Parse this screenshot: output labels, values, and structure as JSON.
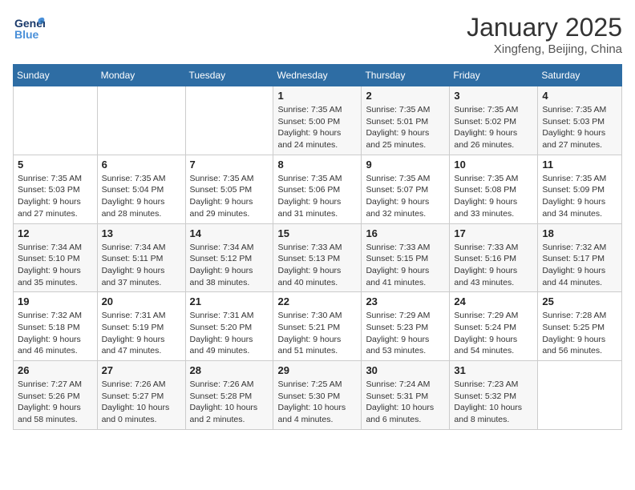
{
  "logo": {
    "line1": "General",
    "line2": "Blue"
  },
  "title": "January 2025",
  "subtitle": "Xingfeng, Beijing, China",
  "days_header": [
    "Sunday",
    "Monday",
    "Tuesday",
    "Wednesday",
    "Thursday",
    "Friday",
    "Saturday"
  ],
  "weeks": [
    [
      {
        "day": "",
        "info": ""
      },
      {
        "day": "",
        "info": ""
      },
      {
        "day": "",
        "info": ""
      },
      {
        "day": "1",
        "info": "Sunrise: 7:35 AM\nSunset: 5:00 PM\nDaylight: 9 hours\nand 24 minutes."
      },
      {
        "day": "2",
        "info": "Sunrise: 7:35 AM\nSunset: 5:01 PM\nDaylight: 9 hours\nand 25 minutes."
      },
      {
        "day": "3",
        "info": "Sunrise: 7:35 AM\nSunset: 5:02 PM\nDaylight: 9 hours\nand 26 minutes."
      },
      {
        "day": "4",
        "info": "Sunrise: 7:35 AM\nSunset: 5:03 PM\nDaylight: 9 hours\nand 27 minutes."
      }
    ],
    [
      {
        "day": "5",
        "info": "Sunrise: 7:35 AM\nSunset: 5:03 PM\nDaylight: 9 hours\nand 27 minutes."
      },
      {
        "day": "6",
        "info": "Sunrise: 7:35 AM\nSunset: 5:04 PM\nDaylight: 9 hours\nand 28 minutes."
      },
      {
        "day": "7",
        "info": "Sunrise: 7:35 AM\nSunset: 5:05 PM\nDaylight: 9 hours\nand 29 minutes."
      },
      {
        "day": "8",
        "info": "Sunrise: 7:35 AM\nSunset: 5:06 PM\nDaylight: 9 hours\nand 31 minutes."
      },
      {
        "day": "9",
        "info": "Sunrise: 7:35 AM\nSunset: 5:07 PM\nDaylight: 9 hours\nand 32 minutes."
      },
      {
        "day": "10",
        "info": "Sunrise: 7:35 AM\nSunset: 5:08 PM\nDaylight: 9 hours\nand 33 minutes."
      },
      {
        "day": "11",
        "info": "Sunrise: 7:35 AM\nSunset: 5:09 PM\nDaylight: 9 hours\nand 34 minutes."
      }
    ],
    [
      {
        "day": "12",
        "info": "Sunrise: 7:34 AM\nSunset: 5:10 PM\nDaylight: 9 hours\nand 35 minutes."
      },
      {
        "day": "13",
        "info": "Sunrise: 7:34 AM\nSunset: 5:11 PM\nDaylight: 9 hours\nand 37 minutes."
      },
      {
        "day": "14",
        "info": "Sunrise: 7:34 AM\nSunset: 5:12 PM\nDaylight: 9 hours\nand 38 minutes."
      },
      {
        "day": "15",
        "info": "Sunrise: 7:33 AM\nSunset: 5:13 PM\nDaylight: 9 hours\nand 40 minutes."
      },
      {
        "day": "16",
        "info": "Sunrise: 7:33 AM\nSunset: 5:15 PM\nDaylight: 9 hours\nand 41 minutes."
      },
      {
        "day": "17",
        "info": "Sunrise: 7:33 AM\nSunset: 5:16 PM\nDaylight: 9 hours\nand 43 minutes."
      },
      {
        "day": "18",
        "info": "Sunrise: 7:32 AM\nSunset: 5:17 PM\nDaylight: 9 hours\nand 44 minutes."
      }
    ],
    [
      {
        "day": "19",
        "info": "Sunrise: 7:32 AM\nSunset: 5:18 PM\nDaylight: 9 hours\nand 46 minutes."
      },
      {
        "day": "20",
        "info": "Sunrise: 7:31 AM\nSunset: 5:19 PM\nDaylight: 9 hours\nand 47 minutes."
      },
      {
        "day": "21",
        "info": "Sunrise: 7:31 AM\nSunset: 5:20 PM\nDaylight: 9 hours\nand 49 minutes."
      },
      {
        "day": "22",
        "info": "Sunrise: 7:30 AM\nSunset: 5:21 PM\nDaylight: 9 hours\nand 51 minutes."
      },
      {
        "day": "23",
        "info": "Sunrise: 7:29 AM\nSunset: 5:23 PM\nDaylight: 9 hours\nand 53 minutes."
      },
      {
        "day": "24",
        "info": "Sunrise: 7:29 AM\nSunset: 5:24 PM\nDaylight: 9 hours\nand 54 minutes."
      },
      {
        "day": "25",
        "info": "Sunrise: 7:28 AM\nSunset: 5:25 PM\nDaylight: 9 hours\nand 56 minutes."
      }
    ],
    [
      {
        "day": "26",
        "info": "Sunrise: 7:27 AM\nSunset: 5:26 PM\nDaylight: 9 hours\nand 58 minutes."
      },
      {
        "day": "27",
        "info": "Sunrise: 7:26 AM\nSunset: 5:27 PM\nDaylight: 10 hours\nand 0 minutes."
      },
      {
        "day": "28",
        "info": "Sunrise: 7:26 AM\nSunset: 5:28 PM\nDaylight: 10 hours\nand 2 minutes."
      },
      {
        "day": "29",
        "info": "Sunrise: 7:25 AM\nSunset: 5:30 PM\nDaylight: 10 hours\nand 4 minutes."
      },
      {
        "day": "30",
        "info": "Sunrise: 7:24 AM\nSunset: 5:31 PM\nDaylight: 10 hours\nand 6 minutes."
      },
      {
        "day": "31",
        "info": "Sunrise: 7:23 AM\nSunset: 5:32 PM\nDaylight: 10 hours\nand 8 minutes."
      },
      {
        "day": "",
        "info": ""
      }
    ]
  ]
}
